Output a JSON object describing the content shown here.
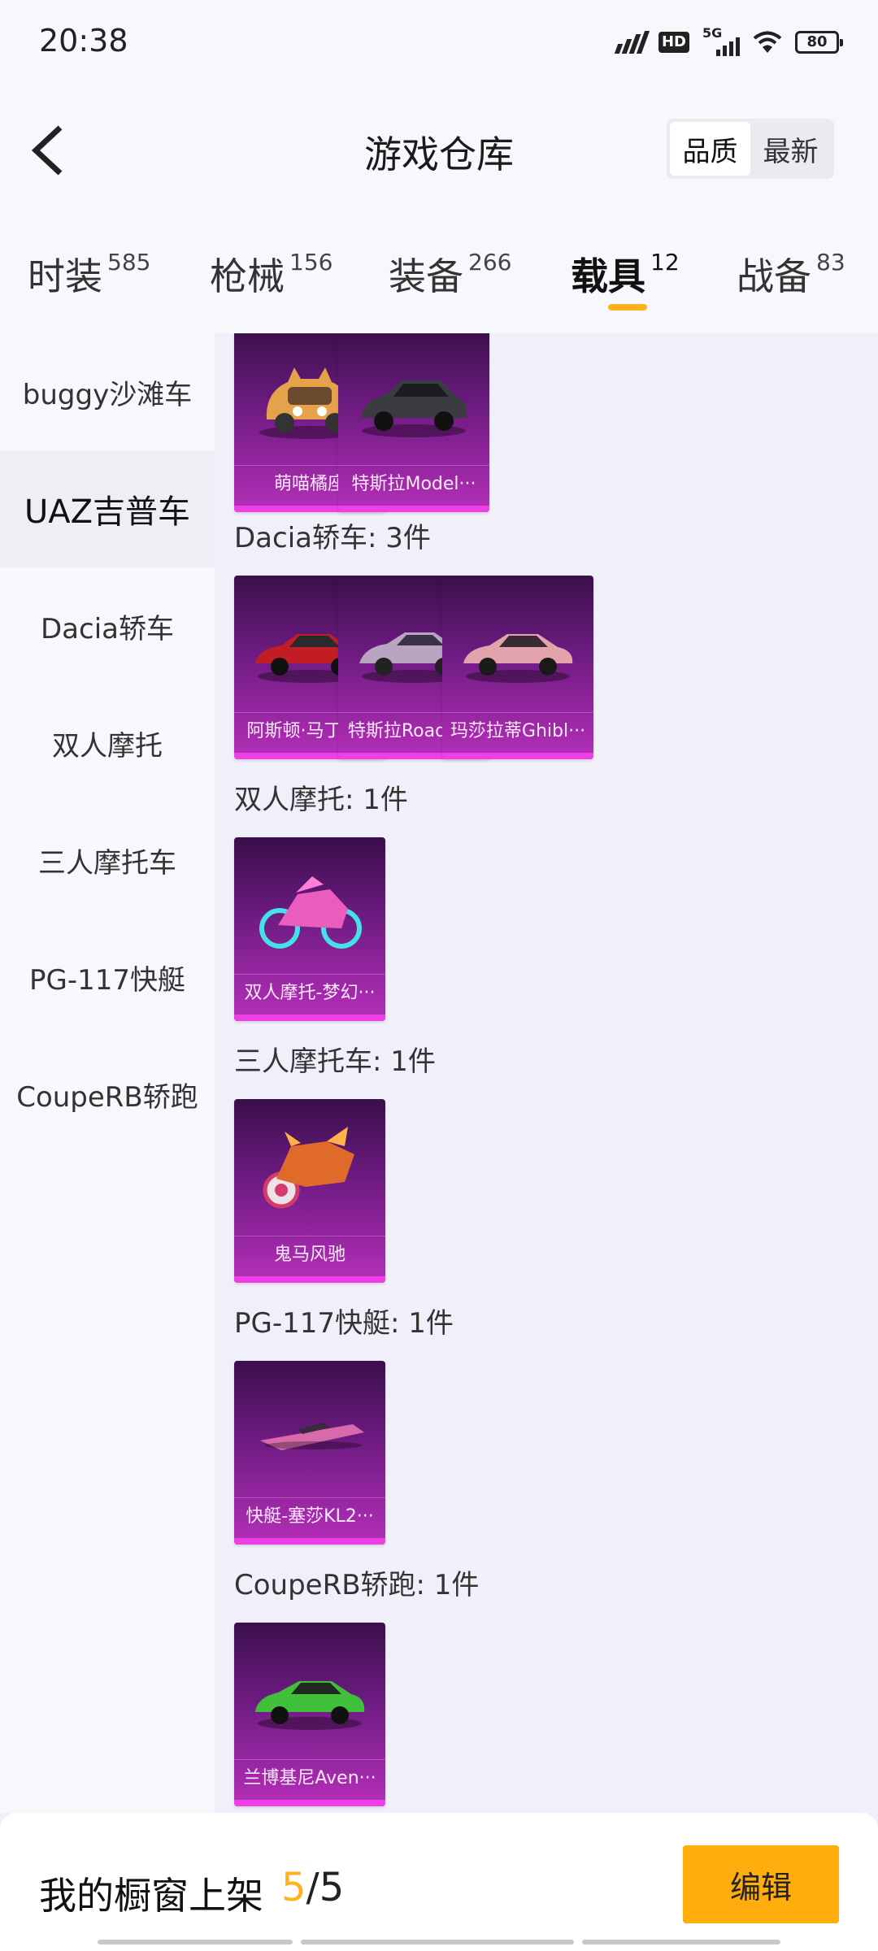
{
  "status_bar": {
    "time": "20:38",
    "hd": "HD",
    "network": "5G",
    "battery": "80"
  },
  "header": {
    "title": "游戏仓库",
    "sort_options": [
      {
        "label": "品质",
        "active": true
      },
      {
        "label": "最新",
        "active": false
      }
    ]
  },
  "tabs": [
    {
      "label": "时装",
      "count": "585"
    },
    {
      "label": "枪械",
      "count": "156"
    },
    {
      "label": "装备",
      "count": "266"
    },
    {
      "label": "载具",
      "count": "12",
      "active": true
    },
    {
      "label": "战备",
      "count": "83"
    }
  ],
  "sidebar": {
    "items": [
      {
        "label": "buggy沙滩车"
      },
      {
        "label": "UAZ吉普车",
        "active": true
      },
      {
        "label": "Dacia轿车"
      },
      {
        "label": "双人摩托"
      },
      {
        "label": "三人摩托车"
      },
      {
        "label": "PG-117快艇"
      },
      {
        "label": "CoupeRB轿跑"
      }
    ]
  },
  "sections": [
    {
      "title": "",
      "items": [
        "萌喵橘座",
        "特斯拉Model···"
      ]
    },
    {
      "title": "Dacia轿车: 3件",
      "items": [
        "阿斯顿·马丁D···",
        "特斯拉Roadst···",
        "玛莎拉蒂Ghibl···"
      ]
    },
    {
      "title": "双人摩托: 1件",
      "items": [
        "双人摩托-梦幻···"
      ]
    },
    {
      "title": "三人摩托车: 1件",
      "items": [
        "鬼马风驰"
      ]
    },
    {
      "title": "PG-117快艇: 1件",
      "items": [
        "快艇-塞莎KL2···"
      ]
    },
    {
      "title": "CoupeRB轿跑: 1件",
      "items": [
        "兰博基尼Aven···"
      ]
    }
  ],
  "bottom_bar": {
    "showcase_label": "我的橱窗上架",
    "showcase_used": "5",
    "showcase_total": "/5",
    "edit_label": "编辑"
  },
  "colors": {
    "accent": "#ffb21d",
    "card_gradient_top": "#3a0f4a",
    "card_gradient_bottom": "#b52fb9",
    "card_edge": "#ee3fe6"
  },
  "icons": [
    "back-arrow-icon",
    "signal-icon",
    "hd-icon",
    "5g-signal-icon",
    "wifi-icon",
    "battery-icon"
  ]
}
